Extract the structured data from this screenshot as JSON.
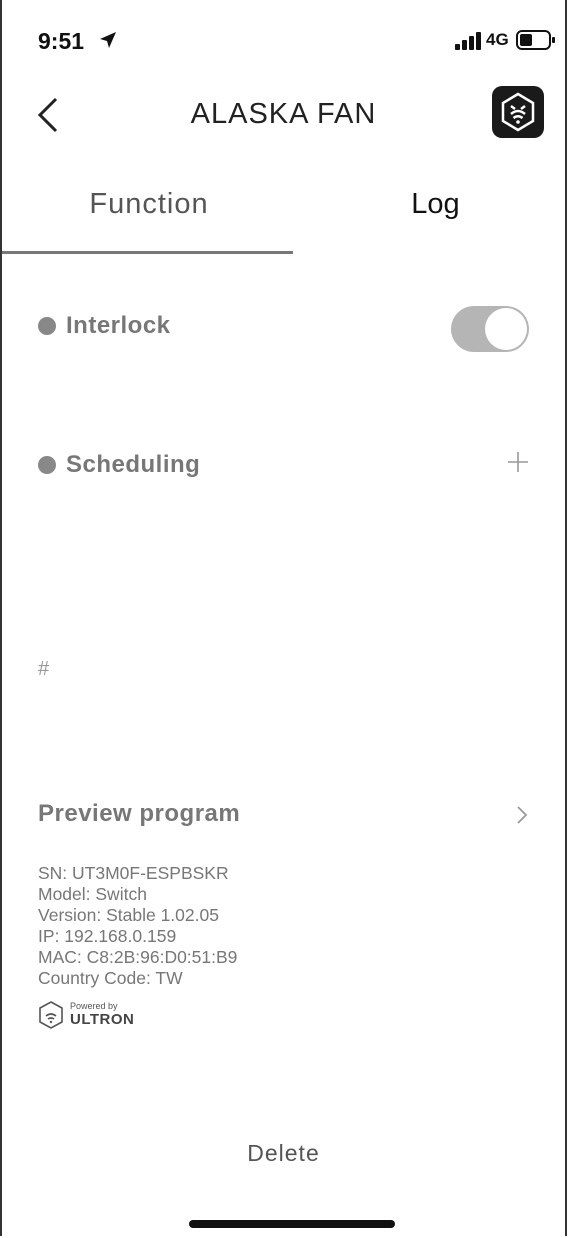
{
  "status_bar": {
    "time": "9:51",
    "network": "4G"
  },
  "header": {
    "title": "ALASKA FAN"
  },
  "tabs": [
    {
      "label": "Function",
      "active": true
    },
    {
      "label": "Log",
      "active": false
    }
  ],
  "interlock": {
    "label": "Interlock",
    "enabled": true
  },
  "scheduling": {
    "label": "Scheduling"
  },
  "hash_text": "#",
  "preview": {
    "label": "Preview program"
  },
  "device_info": {
    "sn": "SN: UT3M0F-ESPBSKR",
    "model": "Model: Switch",
    "version": "Version: Stable 1.02.05",
    "ip": "IP: 192.168.0.159",
    "mac": "MAC: C8:2B:96:D0:51:B9",
    "country": "Country Code: TW"
  },
  "powered": {
    "by": "Powered by",
    "brand": "ULTRON"
  },
  "delete_label": "Delete",
  "colors": {
    "toggle_on": "#b5b5b5",
    "dot": "#888888",
    "indicator": "#777777"
  }
}
